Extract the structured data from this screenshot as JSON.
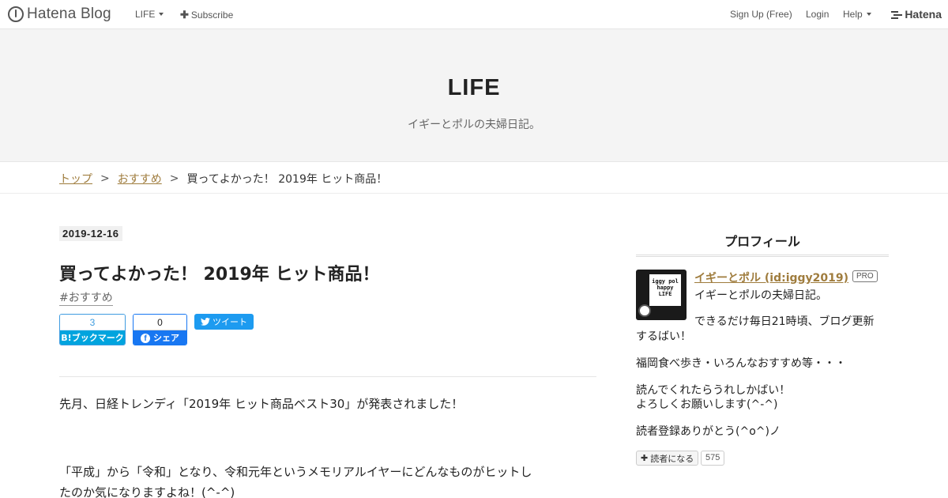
{
  "globalheader": {
    "logo_text": "Hatena Blog",
    "blog_menu": "LIFE",
    "subscribe": "Subscribe",
    "signup": "Sign Up (Free)",
    "login": "Login",
    "help": "Help",
    "brand": "Hatena"
  },
  "blog": {
    "title": "LIFE",
    "description": "イギーとポルの夫婦日記。"
  },
  "breadcrumb": {
    "items": [
      "トップ",
      "おすすめ",
      "買ってよかった！ 2019年 ヒット商品！"
    ],
    "separator": ">"
  },
  "entry": {
    "date": "2019-12-16",
    "title": "買ってよかった！ 2019年 ヒット商品！",
    "category": "#おすすめ",
    "share": {
      "bookmark_count": "3",
      "bookmark_label": "ブックマーク",
      "facebook_count": "0",
      "facebook_label": "シェア",
      "tweet_label": "ツイート"
    },
    "paragraphs": [
      "先月、日経トレンディ「2019年 ヒット商品ベスト30」が発表されました！",
      "「平成」から「令和」となり、令和元年というメモリアルイヤーにどんなものがヒットし",
      "たのか気になりますよね！(^-^)"
    ]
  },
  "sidebar": {
    "title": "プロフィール",
    "avatar_text": [
      "iggy pol",
      "happy",
      "LIFE"
    ],
    "name": "イギーとポル (id:iggy2019)",
    "pro_badge": "PRO",
    "lines": [
      "イギーとポルの夫婦日記。",
      "できるだけ毎日21時頃、ブログ更新",
      "するばい！",
      "福岡食べ歩き・いろんなおすすめ等・・・",
      "読んでくれたらうれしかばい！",
      "よろしくお願いします(^-^)",
      "読者登録ありがとう(^o^)ノ"
    ],
    "subscribe_label": "読者になる",
    "subscribe_count": "575"
  },
  "colors": {
    "link": "#9f7c3d",
    "header_bg": "#f4f4f4",
    "hatena_bookmark": "#00a4de",
    "facebook": "#1877f2",
    "twitter": "#1d9bf0"
  }
}
